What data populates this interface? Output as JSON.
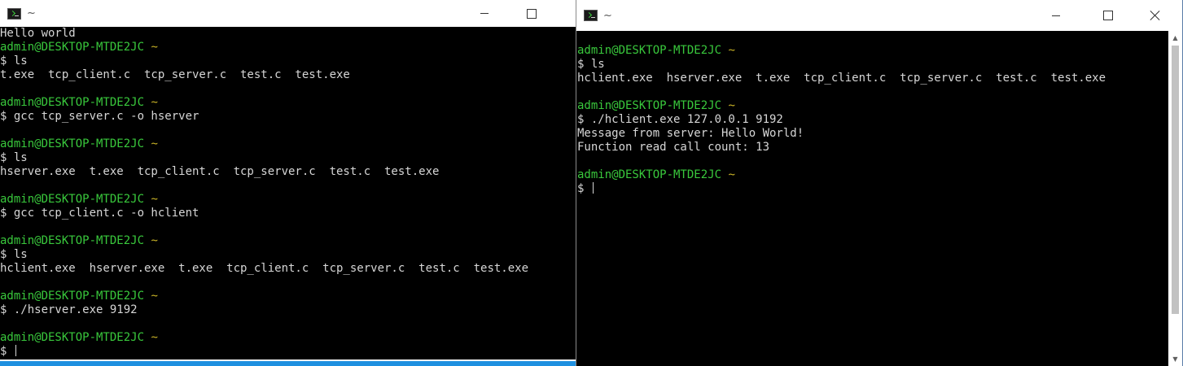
{
  "colors": {
    "terminal_bg": "#000000",
    "text": "#d6d6d6",
    "prompt": "#39c83c",
    "tilde": "#c9b327",
    "taskbar": "#1e90e0"
  },
  "left_window": {
    "title": "~",
    "icon": "terminal-icon",
    "lines": [
      {
        "type": "out",
        "text": "Hello world"
      },
      {
        "type": "prompt",
        "user": "admin@DESKTOP-MTDE2JC",
        "dir": "~"
      },
      {
        "type": "out",
        "text": "$ ls"
      },
      {
        "type": "out",
        "text": "t.exe  tcp_client.c  tcp_server.c  test.c  test.exe"
      },
      {
        "type": "out",
        "text": ""
      },
      {
        "type": "prompt",
        "user": "admin@DESKTOP-MTDE2JC",
        "dir": "~"
      },
      {
        "type": "out",
        "text": "$ gcc tcp_server.c -o hserver"
      },
      {
        "type": "out",
        "text": ""
      },
      {
        "type": "prompt",
        "user": "admin@DESKTOP-MTDE2JC",
        "dir": "~"
      },
      {
        "type": "out",
        "text": "$ ls"
      },
      {
        "type": "out",
        "text": "hserver.exe  t.exe  tcp_client.c  tcp_server.c  test.c  test.exe"
      },
      {
        "type": "out",
        "text": ""
      },
      {
        "type": "prompt",
        "user": "admin@DESKTOP-MTDE2JC",
        "dir": "~"
      },
      {
        "type": "out",
        "text": "$ gcc tcp_client.c -o hclient"
      },
      {
        "type": "out",
        "text": ""
      },
      {
        "type": "prompt",
        "user": "admin@DESKTOP-MTDE2JC",
        "dir": "~"
      },
      {
        "type": "out",
        "text": "$ ls"
      },
      {
        "type": "out",
        "text": "hclient.exe  hserver.exe  t.exe  tcp_client.c  tcp_server.c  test.c  test.exe"
      },
      {
        "type": "out",
        "text": ""
      },
      {
        "type": "prompt",
        "user": "admin@DESKTOP-MTDE2JC",
        "dir": "~"
      },
      {
        "type": "out",
        "text": "$ ./hserver.exe 9192"
      },
      {
        "type": "out",
        "text": ""
      },
      {
        "type": "prompt",
        "user": "admin@DESKTOP-MTDE2JC",
        "dir": "~"
      },
      {
        "type": "cursor",
        "text": "$ "
      }
    ]
  },
  "right_window": {
    "title": "~",
    "icon": "terminal-icon",
    "lines": [
      {
        "type": "prompt",
        "user": "admin@DESKTOP-MTDE2JC",
        "dir": "~"
      },
      {
        "type": "out",
        "text": "$ ls"
      },
      {
        "type": "out",
        "text": "hclient.exe  hserver.exe  t.exe  tcp_client.c  tcp_server.c  test.c  test.exe"
      },
      {
        "type": "out",
        "text": ""
      },
      {
        "type": "prompt",
        "user": "admin@DESKTOP-MTDE2JC",
        "dir": "~"
      },
      {
        "type": "out",
        "text": "$ ./hclient.exe 127.0.0.1 9192"
      },
      {
        "type": "out",
        "text": "Message from server: Hello World!"
      },
      {
        "type": "out",
        "text": "Function read call count: 13"
      },
      {
        "type": "out",
        "text": ""
      },
      {
        "type": "prompt",
        "user": "admin@DESKTOP-MTDE2JC",
        "dir": "~"
      },
      {
        "type": "cursor",
        "text": "$ "
      }
    ]
  }
}
